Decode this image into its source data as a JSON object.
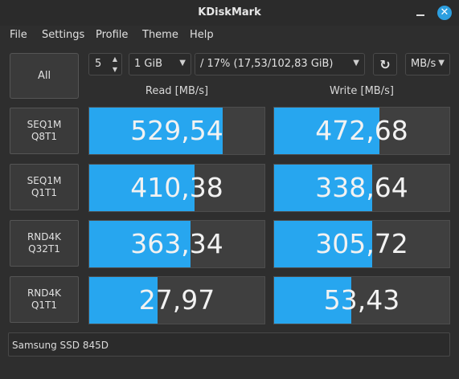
{
  "window": {
    "title": "KDiskMark",
    "close_glyph": "✕"
  },
  "menu": [
    "File",
    "Settings",
    "Profile",
    "Theme",
    "Help"
  ],
  "toolbar": {
    "all_label": "All",
    "runs_value": "5",
    "size_value": "1 GiB",
    "drive_value": "/ 17% (17,53/102,83 GiB)",
    "refresh_icon": "↻",
    "unit_value": "MB/s"
  },
  "columns": {
    "read": "Read [MB/s]",
    "write": "Write [MB/s]"
  },
  "tests": [
    {
      "line1": "SEQ1M",
      "line2": "Q8T1",
      "read": "529,54",
      "write": "472,68",
      "read_fill": 0.76,
      "write_fill": 0.6
    },
    {
      "line1": "SEQ1M",
      "line2": "Q1T1",
      "read": "410,38",
      "write": "338,64",
      "read_fill": 0.6,
      "write_fill": 0.56
    },
    {
      "line1": "RND4K",
      "line2": "Q32T1",
      "read": "363,34",
      "write": "305,72",
      "read_fill": 0.58,
      "write_fill": 0.56
    },
    {
      "line1": "RND4K",
      "line2": "Q1T1",
      "read": "27,97",
      "write": "53,43",
      "read_fill": 0.39,
      "write_fill": 0.44
    }
  ],
  "device_name": "Samsung SSD 845D",
  "colors": {
    "accent": "#27a6ef",
    "close": "#2c9fe0"
  }
}
